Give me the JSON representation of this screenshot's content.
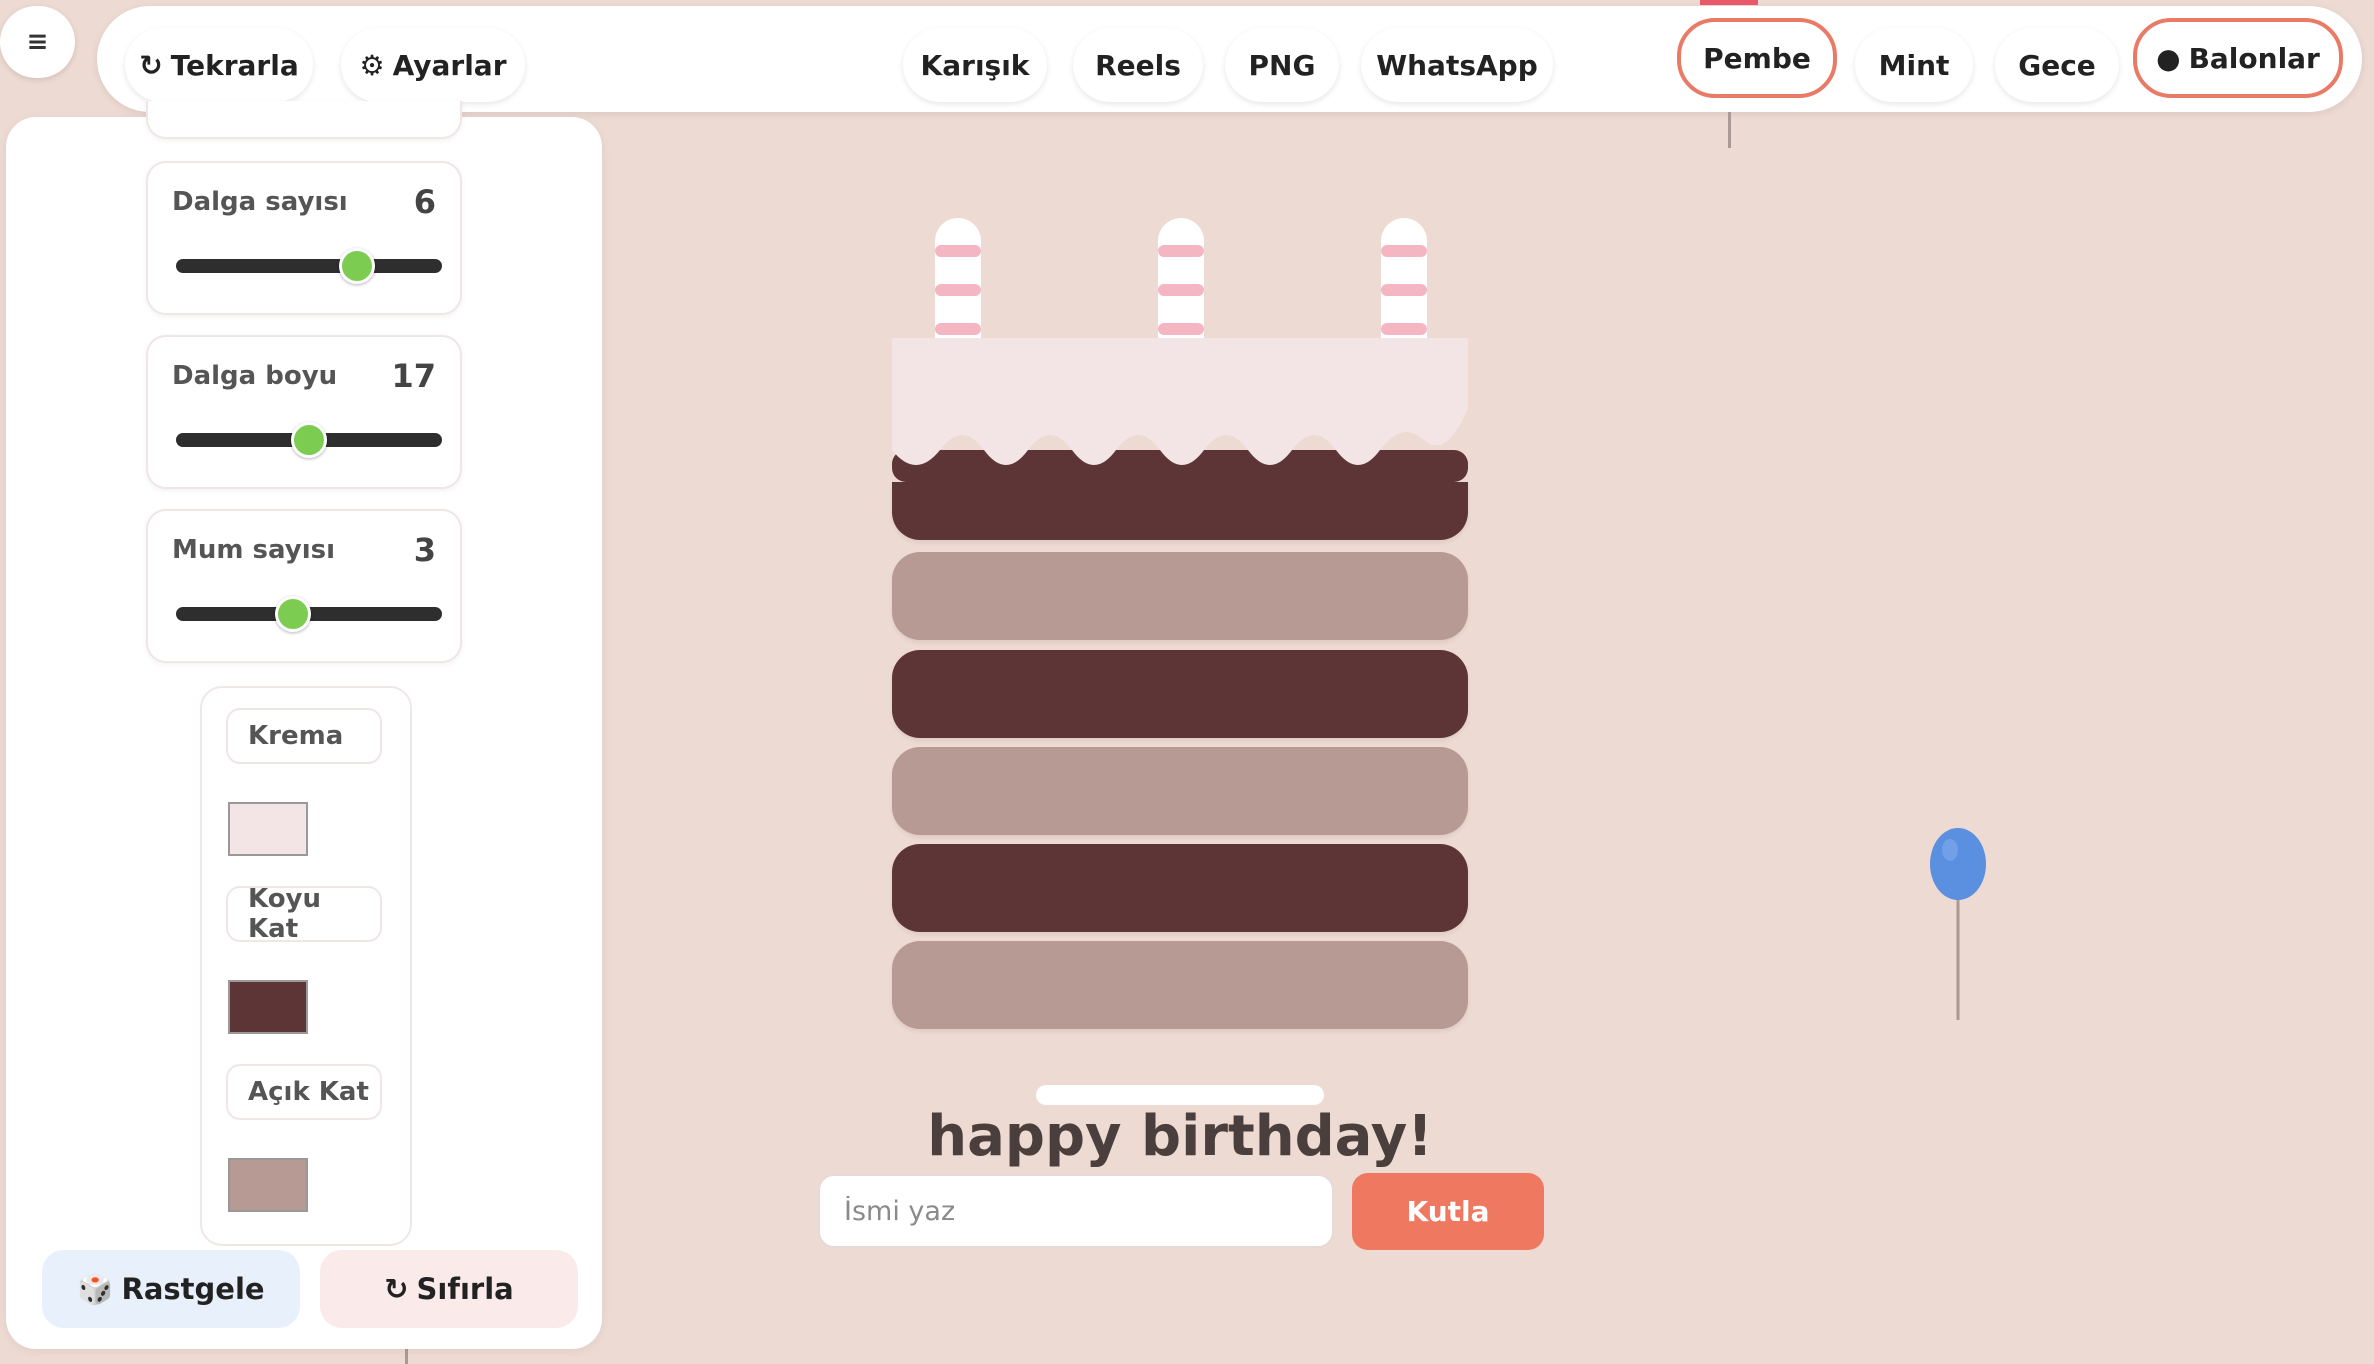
{
  "menu": {
    "icon": "hamburger-icon",
    "glyph": "≡"
  },
  "toolbar": {
    "replay_icon": "↻",
    "replay_label": "Tekrarla",
    "settings_icon": "⚙",
    "settings_label": "Ayarlar",
    "modes": [
      "Karışık",
      "Reels",
      "PNG",
      "WhatsApp"
    ],
    "themes": [
      "Pembe",
      "Mint",
      "Gece"
    ],
    "active_theme": "Pembe",
    "balloons_icon": "●",
    "balloons_label": "Balonlar"
  },
  "sliders": [
    {
      "label": "Dalga sayısı",
      "value": "6",
      "position": 0.68
    },
    {
      "label": "Dalga boyu",
      "value": "17",
      "position": 0.5
    },
    {
      "label": "Mum sayısı",
      "value": "3",
      "position": 0.44
    }
  ],
  "colors": [
    {
      "label": "Krema",
      "color": "#f3e5e6"
    },
    {
      "label": "Koyu Kat",
      "color": "#5e3537"
    },
    {
      "label": "Açık Kat",
      "color": "#b89a94"
    }
  ],
  "actions": {
    "random_icon": "🎲",
    "random_label": "Rastgele",
    "reset_icon": "↻",
    "reset_label": "Sıfırla"
  },
  "cake": {
    "candles": 3,
    "layers": [
      "dark",
      "light",
      "dark",
      "light",
      "dark",
      "light"
    ],
    "frosting_color": "#f3e5e6",
    "dark_color": "#5e3537",
    "light_color": "#b89a94",
    "candle_stripe_color": "#f4b6c3"
  },
  "greeting": "happy birthday!",
  "name_input": {
    "placeholder": "İsmi yaz",
    "value": ""
  },
  "celebrate_label": "Kutla",
  "colors_theme": {
    "accent": "#ee7860",
    "background": "#eddad2",
    "slider_thumb": "#7ccc51",
    "balloon": "#5b8fe0"
  }
}
